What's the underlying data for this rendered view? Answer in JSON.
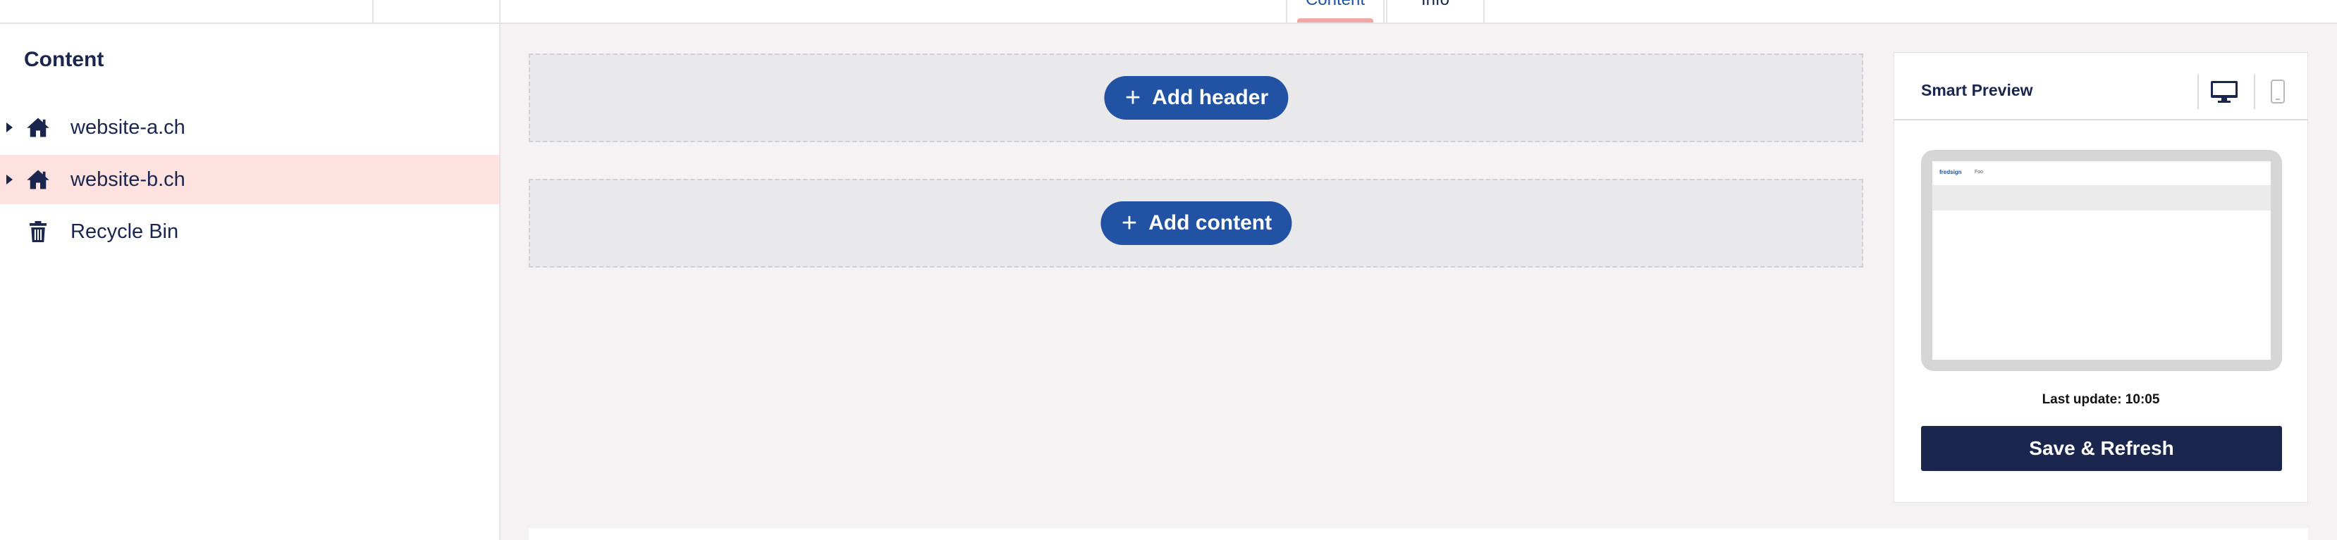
{
  "sidebar": {
    "heading": "Content",
    "items": [
      {
        "label": "website-a.ch",
        "icon": "home-icon",
        "expandable": true,
        "selected": false
      },
      {
        "label": "website-b.ch",
        "icon": "home-icon",
        "expandable": true,
        "selected": true
      },
      {
        "label": "Recycle Bin",
        "icon": "trash-icon",
        "expandable": false,
        "selected": false
      }
    ]
  },
  "tabs": [
    {
      "label": "Content",
      "active": true
    },
    {
      "label": "Info",
      "active": false
    }
  ],
  "editor": {
    "add_header_label": "Add header",
    "add_content_label": "Add content"
  },
  "preview": {
    "title": "Smart Preview",
    "device_desktop_icon": "desktop-icon",
    "device_mobile_icon": "mobile-icon",
    "mini_logo": "fredsign",
    "mini_link": "Foo",
    "last_update": "Last update: 10:05",
    "save_label": "Save & Refresh"
  },
  "colors": {
    "primary": "#2152a3",
    "navy": "#1b264f",
    "selected_bg": "#fde2df",
    "tab_accent": "#f3a7a2"
  }
}
